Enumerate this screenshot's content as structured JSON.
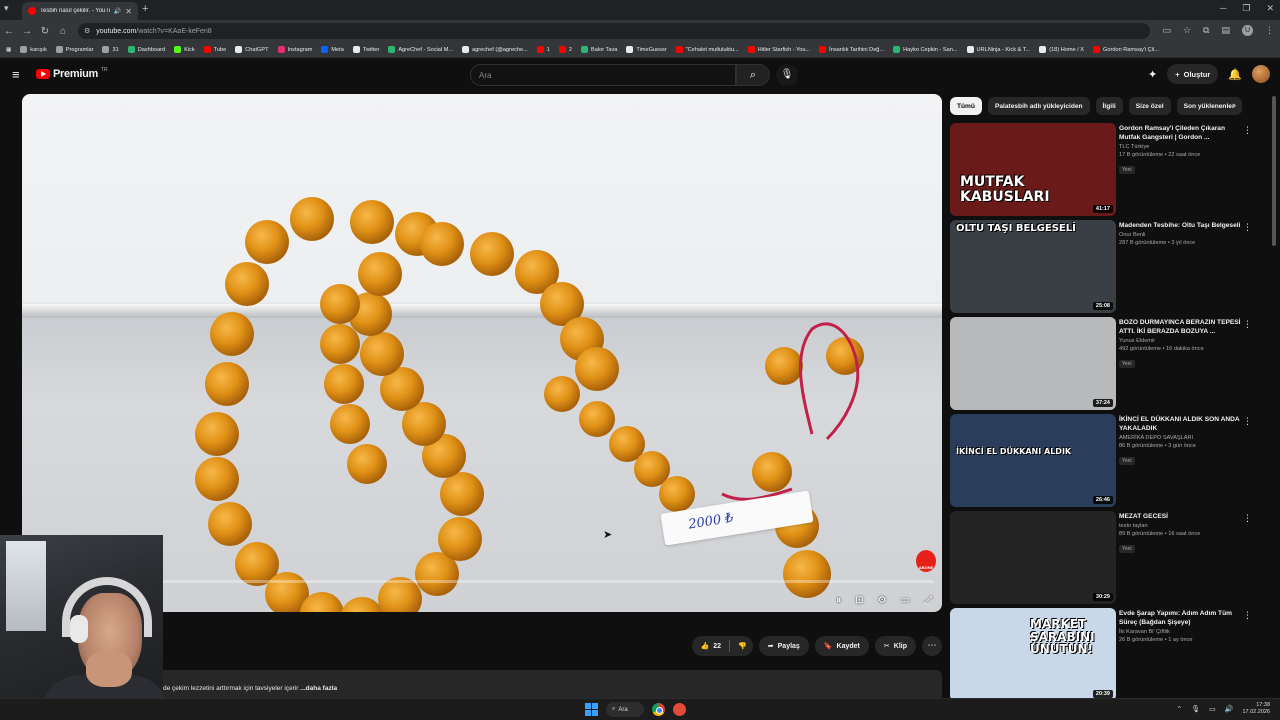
{
  "browser": {
    "tab_title": "Tesbih nasıl çekilir. - YouTube",
    "url_host": "youtube.com",
    "url_path": "/watch?v=KAaE-keFen8",
    "bookmarks": [
      {
        "label": "karışık",
        "color": "#9aa0a6"
      },
      {
        "label": "Programlar",
        "color": "#9aa0a6"
      },
      {
        "label": "31",
        "color": "#9aa0a6"
      },
      {
        "label": "Dashboard",
        "color": "#2bb673"
      },
      {
        "label": "Kick",
        "color": "#53fc18"
      },
      {
        "label": "Tube",
        "color": "#ff0000"
      },
      {
        "label": "ChatGPT",
        "color": "#e8eaed"
      },
      {
        "label": "Instagram",
        "color": "#e1306c"
      },
      {
        "label": "Meta",
        "color": "#0866ff"
      },
      {
        "label": "Twitter",
        "color": "#e8eaed"
      },
      {
        "label": "AgreChef - Social M...",
        "color": "#2bb673"
      },
      {
        "label": "agrechef (@agreche...",
        "color": "#e8eaed"
      },
      {
        "label": "1",
        "color": "#ff0000"
      },
      {
        "label": "2",
        "color": "#ff0000"
      },
      {
        "label": "Balor Tava",
        "color": "#2bb673"
      },
      {
        "label": "TimeGuessr",
        "color": "#e8eaed"
      },
      {
        "label": "\"Cehalet mutluluktu...",
        "color": "#ff0000"
      },
      {
        "label": "Hitler Starfish - You...",
        "color": "#ff0000"
      },
      {
        "label": "İnsanlık Tarihini Değ...",
        "color": "#ff0000"
      },
      {
        "label": "Hayko Cepkin - San...",
        "color": "#2bb673"
      },
      {
        "label": "URLNinja - Kick & T...",
        "color": "#e8eaed"
      },
      {
        "label": "(18) Home / X",
        "color": "#e8eaed"
      },
      {
        "label": "Gordon Ramsay'i Çil...",
        "color": "#ff0000"
      }
    ]
  },
  "youtube": {
    "logo_text": "Premium",
    "logo_sup": "TR",
    "search_placeholder": "Ara",
    "create_label": "Oluştur"
  },
  "player": {
    "tag_text": "2000 ₺",
    "progress_fraction": 0.0
  },
  "actions": {
    "like_count": "22",
    "share_label": "Paylaş",
    "save_label": "Kaydet",
    "clip_label": "Klip"
  },
  "description": {
    "text": "de çekim lezzetini arttırmak için tavsiyeler içerir",
    "more_label": "...daha fazla"
  },
  "chips": [
    "Tümü",
    "Palatesbih adlı yükleyiciden",
    "İlgili",
    "Size özel",
    "Son yüklenenler"
  ],
  "recommendations": [
    {
      "title": "Gordon Ramsay'i Çileden Çıkaran Mutfak Gangsteri | Gordon ...",
      "channel": "TLC Türkiye",
      "stats": "17 B görüntüleme • 22 saat önce",
      "badge": "Yeni",
      "duration": "41:17",
      "thumb_text": "MUTFAK KABUSLARI",
      "thumb_bg": "#6b1a1a"
    },
    {
      "title": "Madenden Tesbihe: Oltu Taşı Belgeseli",
      "channel": "Onur Benli",
      "stats": "287 B görüntüleme • 3 yıl önce",
      "badge": "",
      "duration": "25:08",
      "thumb_text": "OLTU TAŞI BELGESELİ",
      "thumb_bg": "#3a3f46"
    },
    {
      "title": "BOZO DURMAYINCA BERAZIN TEPESİ ATTI. İKİ BERAZDA BOZUYA ...",
      "channel": "Yunus Eldemir",
      "stats": "492 görüntüleme • 16 dakika önce",
      "badge": "Yeni",
      "duration": "37:24",
      "thumb_text": "",
      "thumb_bg": "#b7b9bb"
    },
    {
      "title": "İKİNCİ EL DÜKKANI ALDIK SON ANDA YAKALADIK",
      "channel": "AMERİKA DEPO SAVAŞLARI",
      "stats": "86 B görüntüleme • 3 gün önce",
      "badge": "Yeni",
      "duration": "26:46",
      "thumb_text": "İKİNCİ EL DÜKKANI ALDIK",
      "thumb_bg": "#2a3d5a"
    },
    {
      "title": "MEZAT GECESİ",
      "channel": "testo taylan",
      "stats": "89 B görüntüleme • 16 saat önce",
      "badge": "Yeni",
      "duration": "30:29",
      "thumb_text": "",
      "thumb_bg": "#242424"
    },
    {
      "title": "Evde Şarap Yapımı: Adım Adım Tüm Süreç (Bağdan Şişeye)",
      "channel": "İki Karavan Bi' Çiftlik",
      "stats": "26 B görüntüleme • 1 ay önce",
      "badge": "",
      "duration": "20:39",
      "thumb_text": "MARKET ŞARABINI UNUTUN!",
      "thumb_bg": "#c8d8e8"
    }
  ],
  "taskbar": {
    "search_label": "Ara",
    "time": "17:38",
    "date": "17.02.2026"
  }
}
